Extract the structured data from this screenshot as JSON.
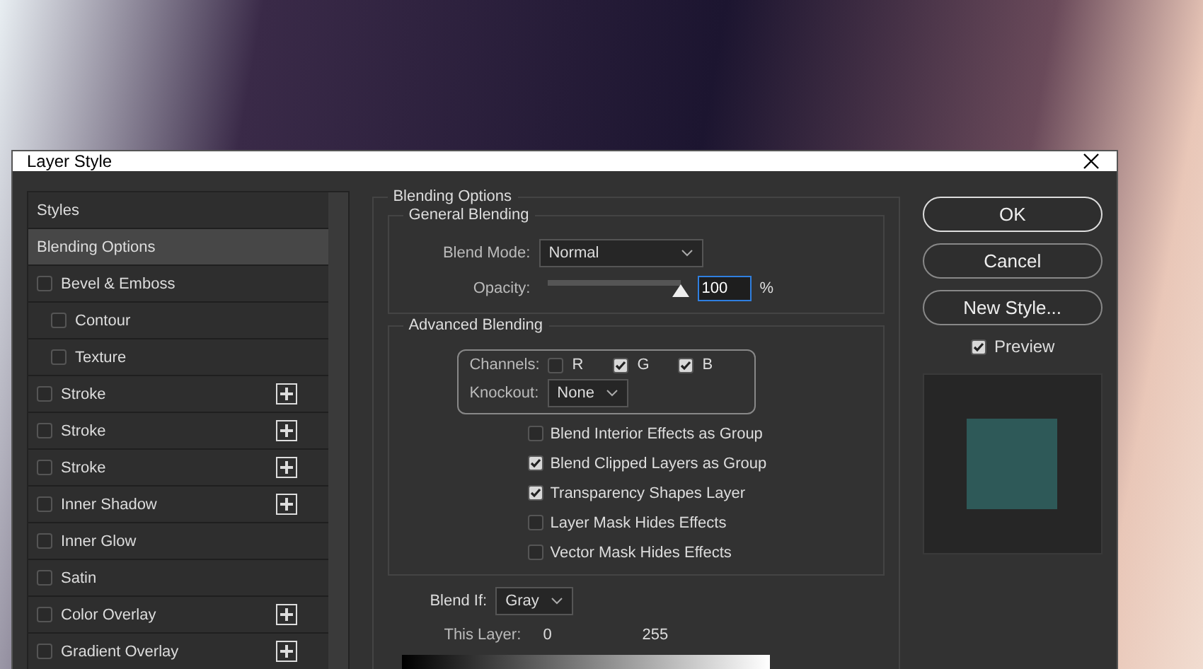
{
  "window": {
    "title": "Layer Style"
  },
  "sidebar": {
    "header": "Styles",
    "items": [
      {
        "label": "Blending Options",
        "kind": "section",
        "selected": true
      },
      {
        "label": "Bevel & Emboss",
        "kind": "effect",
        "checked": false,
        "selected": false,
        "addable": false,
        "children": [
          {
            "label": "Contour",
            "checked": false,
            "selected": false
          },
          {
            "label": "Texture",
            "checked": false,
            "selected": false
          }
        ]
      },
      {
        "label": "Stroke",
        "kind": "effect",
        "checked": false,
        "selected": false,
        "addable": true
      },
      {
        "label": "Stroke",
        "kind": "effect",
        "checked": false,
        "selected": false,
        "addable": true
      },
      {
        "label": "Stroke",
        "kind": "effect",
        "checked": false,
        "selected": false,
        "addable": true
      },
      {
        "label": "Inner Shadow",
        "kind": "effect",
        "checked": false,
        "selected": false,
        "addable": true
      },
      {
        "label": "Inner Glow",
        "kind": "effect",
        "checked": false,
        "selected": false,
        "addable": false
      },
      {
        "label": "Satin",
        "kind": "effect",
        "checked": false,
        "selected": false,
        "addable": false
      },
      {
        "label": "Color Overlay",
        "kind": "effect",
        "checked": false,
        "selected": false,
        "addable": true
      },
      {
        "label": "Gradient Overlay",
        "kind": "effect",
        "checked": false,
        "selected": false,
        "addable": true
      }
    ]
  },
  "blending_options": {
    "title": "Blending Options",
    "general_blending": {
      "title": "General Blending",
      "blend_mode": {
        "label": "Blend Mode:",
        "value": "Normal"
      },
      "opacity": {
        "label": "Opacity:",
        "level": 1,
        "value": "100",
        "unit": "%"
      }
    },
    "advanced_blending": {
      "title": "Advanced Blending",
      "channels": {
        "label": "Channels:",
        "items": [
          {
            "label": "R",
            "checked": false
          },
          {
            "label": "G",
            "checked": true
          },
          {
            "label": "B",
            "checked": true
          }
        ]
      },
      "knockout": {
        "label": "Knockout:",
        "value": "None"
      },
      "options": [
        {
          "label": "Blend Interior Effects as Group",
          "checked": false
        },
        {
          "label": "Blend Clipped Layers as Group",
          "checked": true
        },
        {
          "label": "Transparency Shapes Layer",
          "checked": true
        },
        {
          "label": "Layer Mask Hides Effects",
          "checked": false
        },
        {
          "label": "Vector Mask Hides Effects",
          "checked": false
        }
      ]
    },
    "blend_if": {
      "label": "Blend If:",
      "value": "Gray",
      "this_layer": {
        "label": "This Layer:",
        "min": "0",
        "max": "255"
      }
    }
  },
  "buttons": [
    {
      "label": "OK",
      "default": true
    },
    {
      "label": "Cancel",
      "default": false
    },
    {
      "label": "New Style...",
      "default": false
    }
  ],
  "preview": {
    "label": "Preview",
    "checked": true
  }
}
